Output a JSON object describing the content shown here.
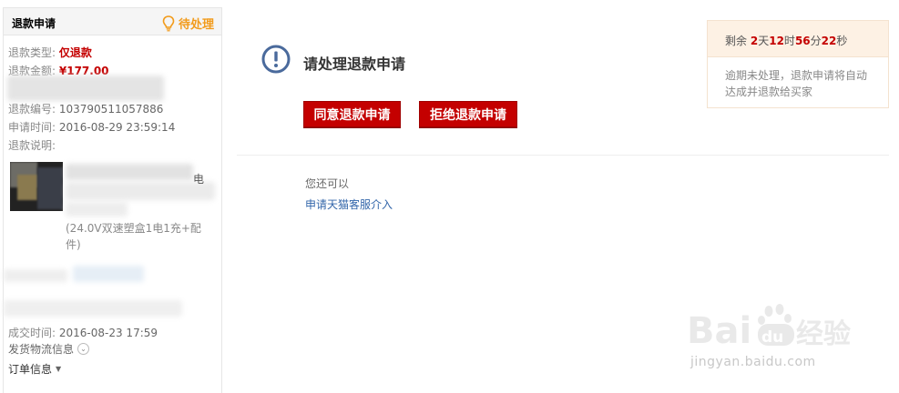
{
  "left_panel": {
    "title": "退款申请",
    "status": "待处理",
    "refund_type_label": "退款类型:",
    "refund_type_value": "仅退款",
    "refund_amount_label": "退款金额:",
    "refund_amount_value": "¥177.00",
    "refund_no_label": "退款编号:",
    "refund_no_value": "103790511057886",
    "apply_time_label": "申请时间:",
    "apply_time_value": "2016-08-29 23:59:14",
    "refund_desc_label": "退款说明:",
    "product_title_fragment": "电",
    "product_spec": "(24.0V双速塑盒1电1充+配件)",
    "deal_time_label": "成交时间:",
    "deal_time_value": "2016-08-23 17:59",
    "logistics_label": "发货物流信息",
    "order_info_label": "订单信息"
  },
  "main": {
    "title": "请处理退款申请",
    "agree_button": "同意退款申请",
    "refuse_button": "拒绝退款申请",
    "also_text": "您还可以",
    "apply_link": "申请天猫客服介入"
  },
  "timer": {
    "prefix": "剩余",
    "days": "2",
    "days_unit": "天",
    "hours": "12",
    "hours_unit": "时",
    "minutes": "56",
    "minutes_unit": "分",
    "seconds": "22",
    "seconds_unit": "秒",
    "note": "逾期未处理，退款申请将自动达成并退款给买家"
  },
  "watermark": {
    "brand": "Bai",
    "brand2": "du",
    "brand3": "经验",
    "url": "jingyan.baidu.com"
  },
  "colors": {
    "accent_red": "#c40000",
    "pending_orange": "#f29b1b",
    "link_blue": "#3366aa",
    "icon_blue": "#4a6a9c"
  }
}
